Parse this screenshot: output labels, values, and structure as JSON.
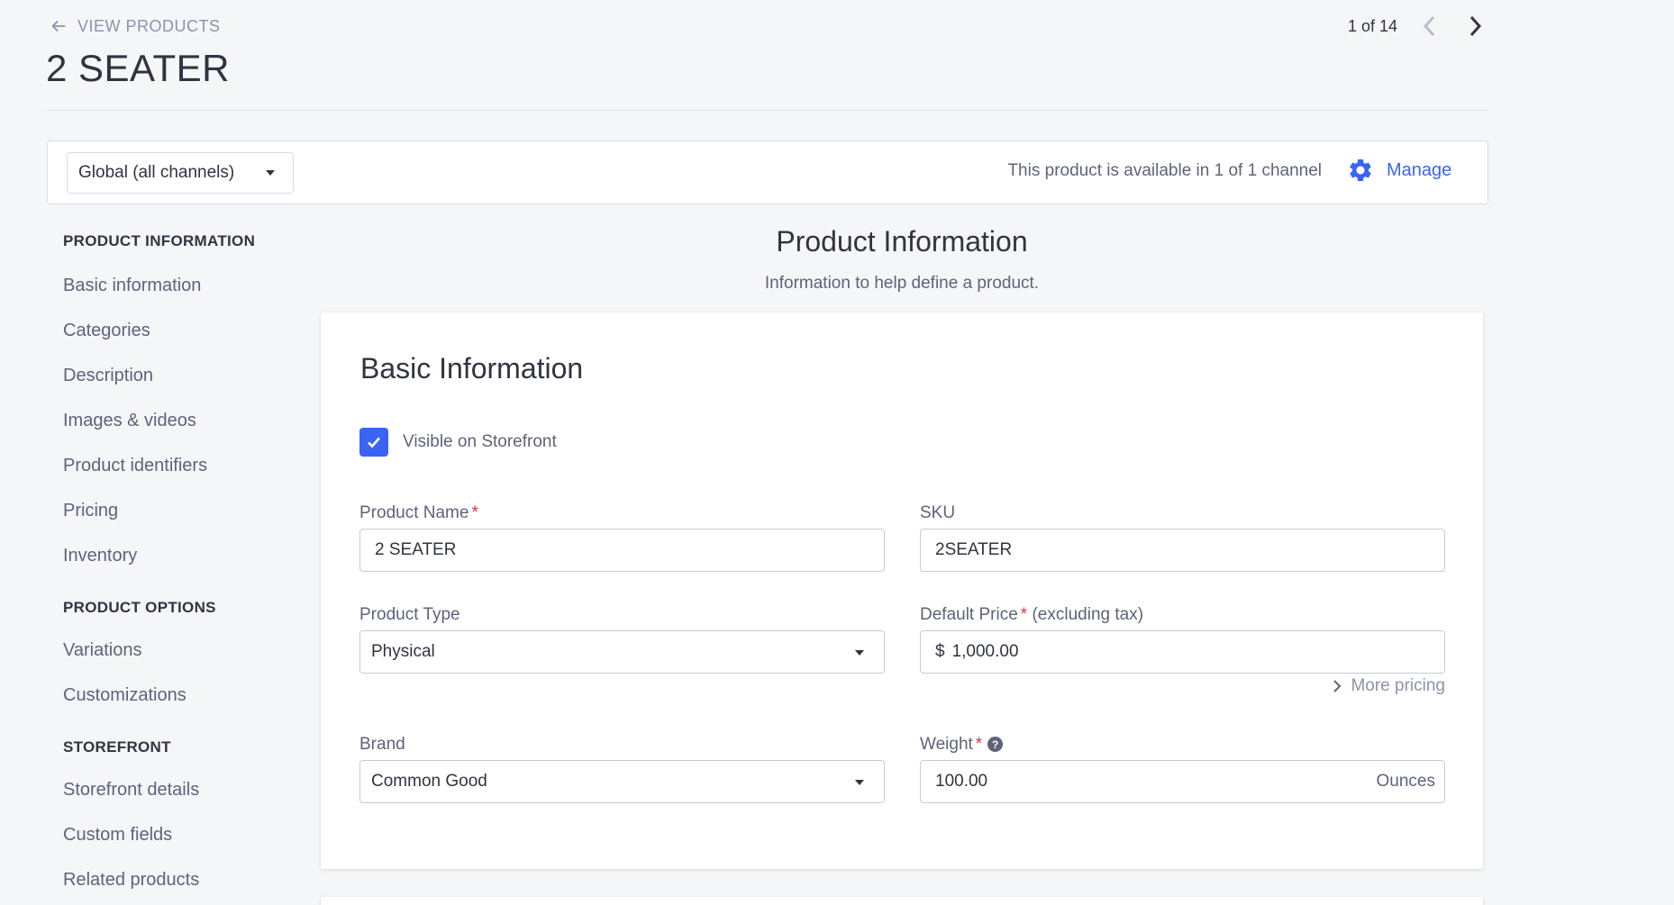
{
  "header": {
    "back_label": "VIEW PRODUCTS",
    "title": "2 SEATER",
    "pager": "1 of 14"
  },
  "channel_bar": {
    "selected_channel": "Global (all channels)",
    "availability": "This product is available in 1 of 1 channel",
    "manage_label": "Manage"
  },
  "sidebar": {
    "groups": [
      {
        "heading": "PRODUCT INFORMATION",
        "items": [
          "Basic information",
          "Categories",
          "Description",
          "Images & videos",
          "Product identifiers",
          "Pricing",
          "Inventory"
        ]
      },
      {
        "heading": "PRODUCT OPTIONS",
        "items": [
          "Variations",
          "Customizations"
        ]
      },
      {
        "heading": "STOREFRONT",
        "items": [
          "Storefront details",
          "Custom fields",
          "Related products"
        ]
      }
    ]
  },
  "section": {
    "title": "Product Information",
    "subtitle": "Information to help define a product."
  },
  "basic_info": {
    "title": "Basic Information",
    "visible_label": "Visible on Storefront",
    "visible_checked": true,
    "product_name_label": "Product Name",
    "product_name_value": "2 SEATER",
    "sku_label": "SKU",
    "sku_value": "2SEATER",
    "product_type_label": "Product Type",
    "product_type_value": "Physical",
    "default_price_label": "Default Price",
    "default_price_suffix": "(excluding tax)",
    "price_currency": "$",
    "default_price_value": "1,000.00",
    "more_pricing_label": "More pricing",
    "brand_label": "Brand",
    "brand_value": "Common Good",
    "weight_label": "Weight",
    "weight_value": "100.00",
    "weight_unit": "Ounces",
    "required_mark": "*",
    "help_glyph": "?"
  },
  "colors": {
    "accent": "#3c64f4",
    "required": "#db3643",
    "background": "#f5f6f8"
  }
}
